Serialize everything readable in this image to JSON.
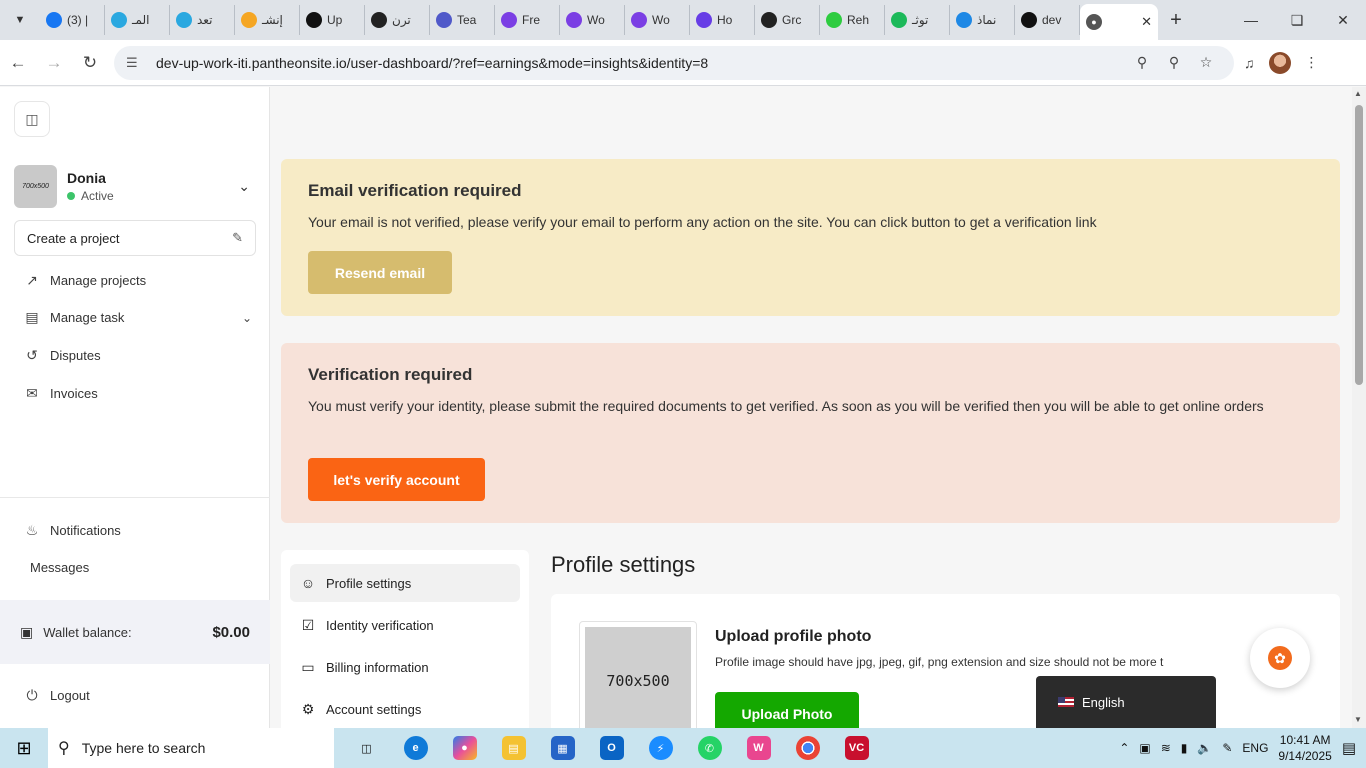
{
  "browser": {
    "tabs": [
      {
        "label": "(3) |",
        "icon": "facebook-icon",
        "color": "#1877f2"
      },
      {
        "label": "المـ",
        "icon": "circle-icon",
        "color": "#2aa8e0"
      },
      {
        "label": "تعد",
        "icon": "circle-icon",
        "color": "#2aa8e0"
      },
      {
        "label": "إنشـ",
        "icon": "five-icon",
        "color": "#f5a623"
      },
      {
        "label": "Up",
        "icon": "upwork-icon",
        "color": "#111111"
      },
      {
        "label": "ترن",
        "icon": "openai-icon",
        "color": "#222222"
      },
      {
        "label": "Tea",
        "icon": "teams-icon",
        "color": "#5059c9"
      },
      {
        "label": "Fre",
        "icon": "play-icon",
        "color": "#7b3fe4"
      },
      {
        "label": "Wo",
        "icon": "play-icon",
        "color": "#7b3fe4"
      },
      {
        "label": "Wo",
        "icon": "play-icon",
        "color": "#7b3fe4"
      },
      {
        "label": "Ho",
        "icon": "hostinger-icon",
        "color": "#673de6"
      },
      {
        "label": "Grc",
        "icon": "grok-icon",
        "color": "#222222"
      },
      {
        "label": "Reh",
        "icon": "leaf-icon",
        "color": "#2ecc40"
      },
      {
        "label": "توثـ",
        "icon": "k-icon",
        "color": "#1cb95a"
      },
      {
        "label": "نماذ",
        "icon": "swirl-icon",
        "color": "#1e88e5"
      },
      {
        "label": "dev",
        "icon": "upwork-icon",
        "color": "#111111"
      }
    ],
    "active_tab": {
      "label": "",
      "icon": "globe-icon"
    },
    "url": "dev-up-work-iti.pantheonsite.io/user-dashboard/?ref=earnings&mode=insights&identity=8"
  },
  "sidebar": {
    "user": {
      "name": "Donia",
      "status": "Active",
      "photo_label": "700x500"
    },
    "create_project": "Create a project",
    "menu": [
      {
        "label": "Manage projects",
        "icon": "external-link-icon"
      },
      {
        "label": "Manage task",
        "icon": "document-icon"
      },
      {
        "label": "Disputes",
        "icon": "refresh-icon"
      },
      {
        "label": "Invoices",
        "icon": "mail-icon"
      }
    ],
    "notifications": "Notifications",
    "messages": "Messages",
    "wallet_label": "Wallet balance:",
    "wallet_amount": "$0.00",
    "logout": "Logout"
  },
  "alerts": {
    "email": {
      "title": "Email verification required",
      "text": "Your email is not verified, please verify your email to perform any action on the site. You can click button to get a verification link",
      "button": "Resend email"
    },
    "identity": {
      "title": "Verification required",
      "text": "You must verify your identity, please submit the required documents to get verified. As soon as you will be verified then you will be able to get online orders",
      "button": "let's verify account"
    }
  },
  "settings_nav": [
    {
      "label": "Profile settings",
      "icon": "user-icon",
      "active": true
    },
    {
      "label": "Identity verification",
      "icon": "checkbox-icon",
      "active": false
    },
    {
      "label": "Billing information",
      "icon": "card-icon",
      "active": false
    },
    {
      "label": "Account settings",
      "icon": "gear-icon",
      "active": false
    }
  ],
  "profile_settings": {
    "title": "Profile settings",
    "upload_title": "Upload profile photo",
    "upload_text": "Profile image should have jpg, jpeg, gif, png extension and size should not be more t",
    "photo_placeholder": "700x500",
    "upload_button": "Upload Photo"
  },
  "language": {
    "label": "English"
  },
  "taskbar": {
    "search_placeholder": "Type here to search",
    "language": "ENG",
    "time": "10:41 AM",
    "date": "9/14/2025"
  }
}
